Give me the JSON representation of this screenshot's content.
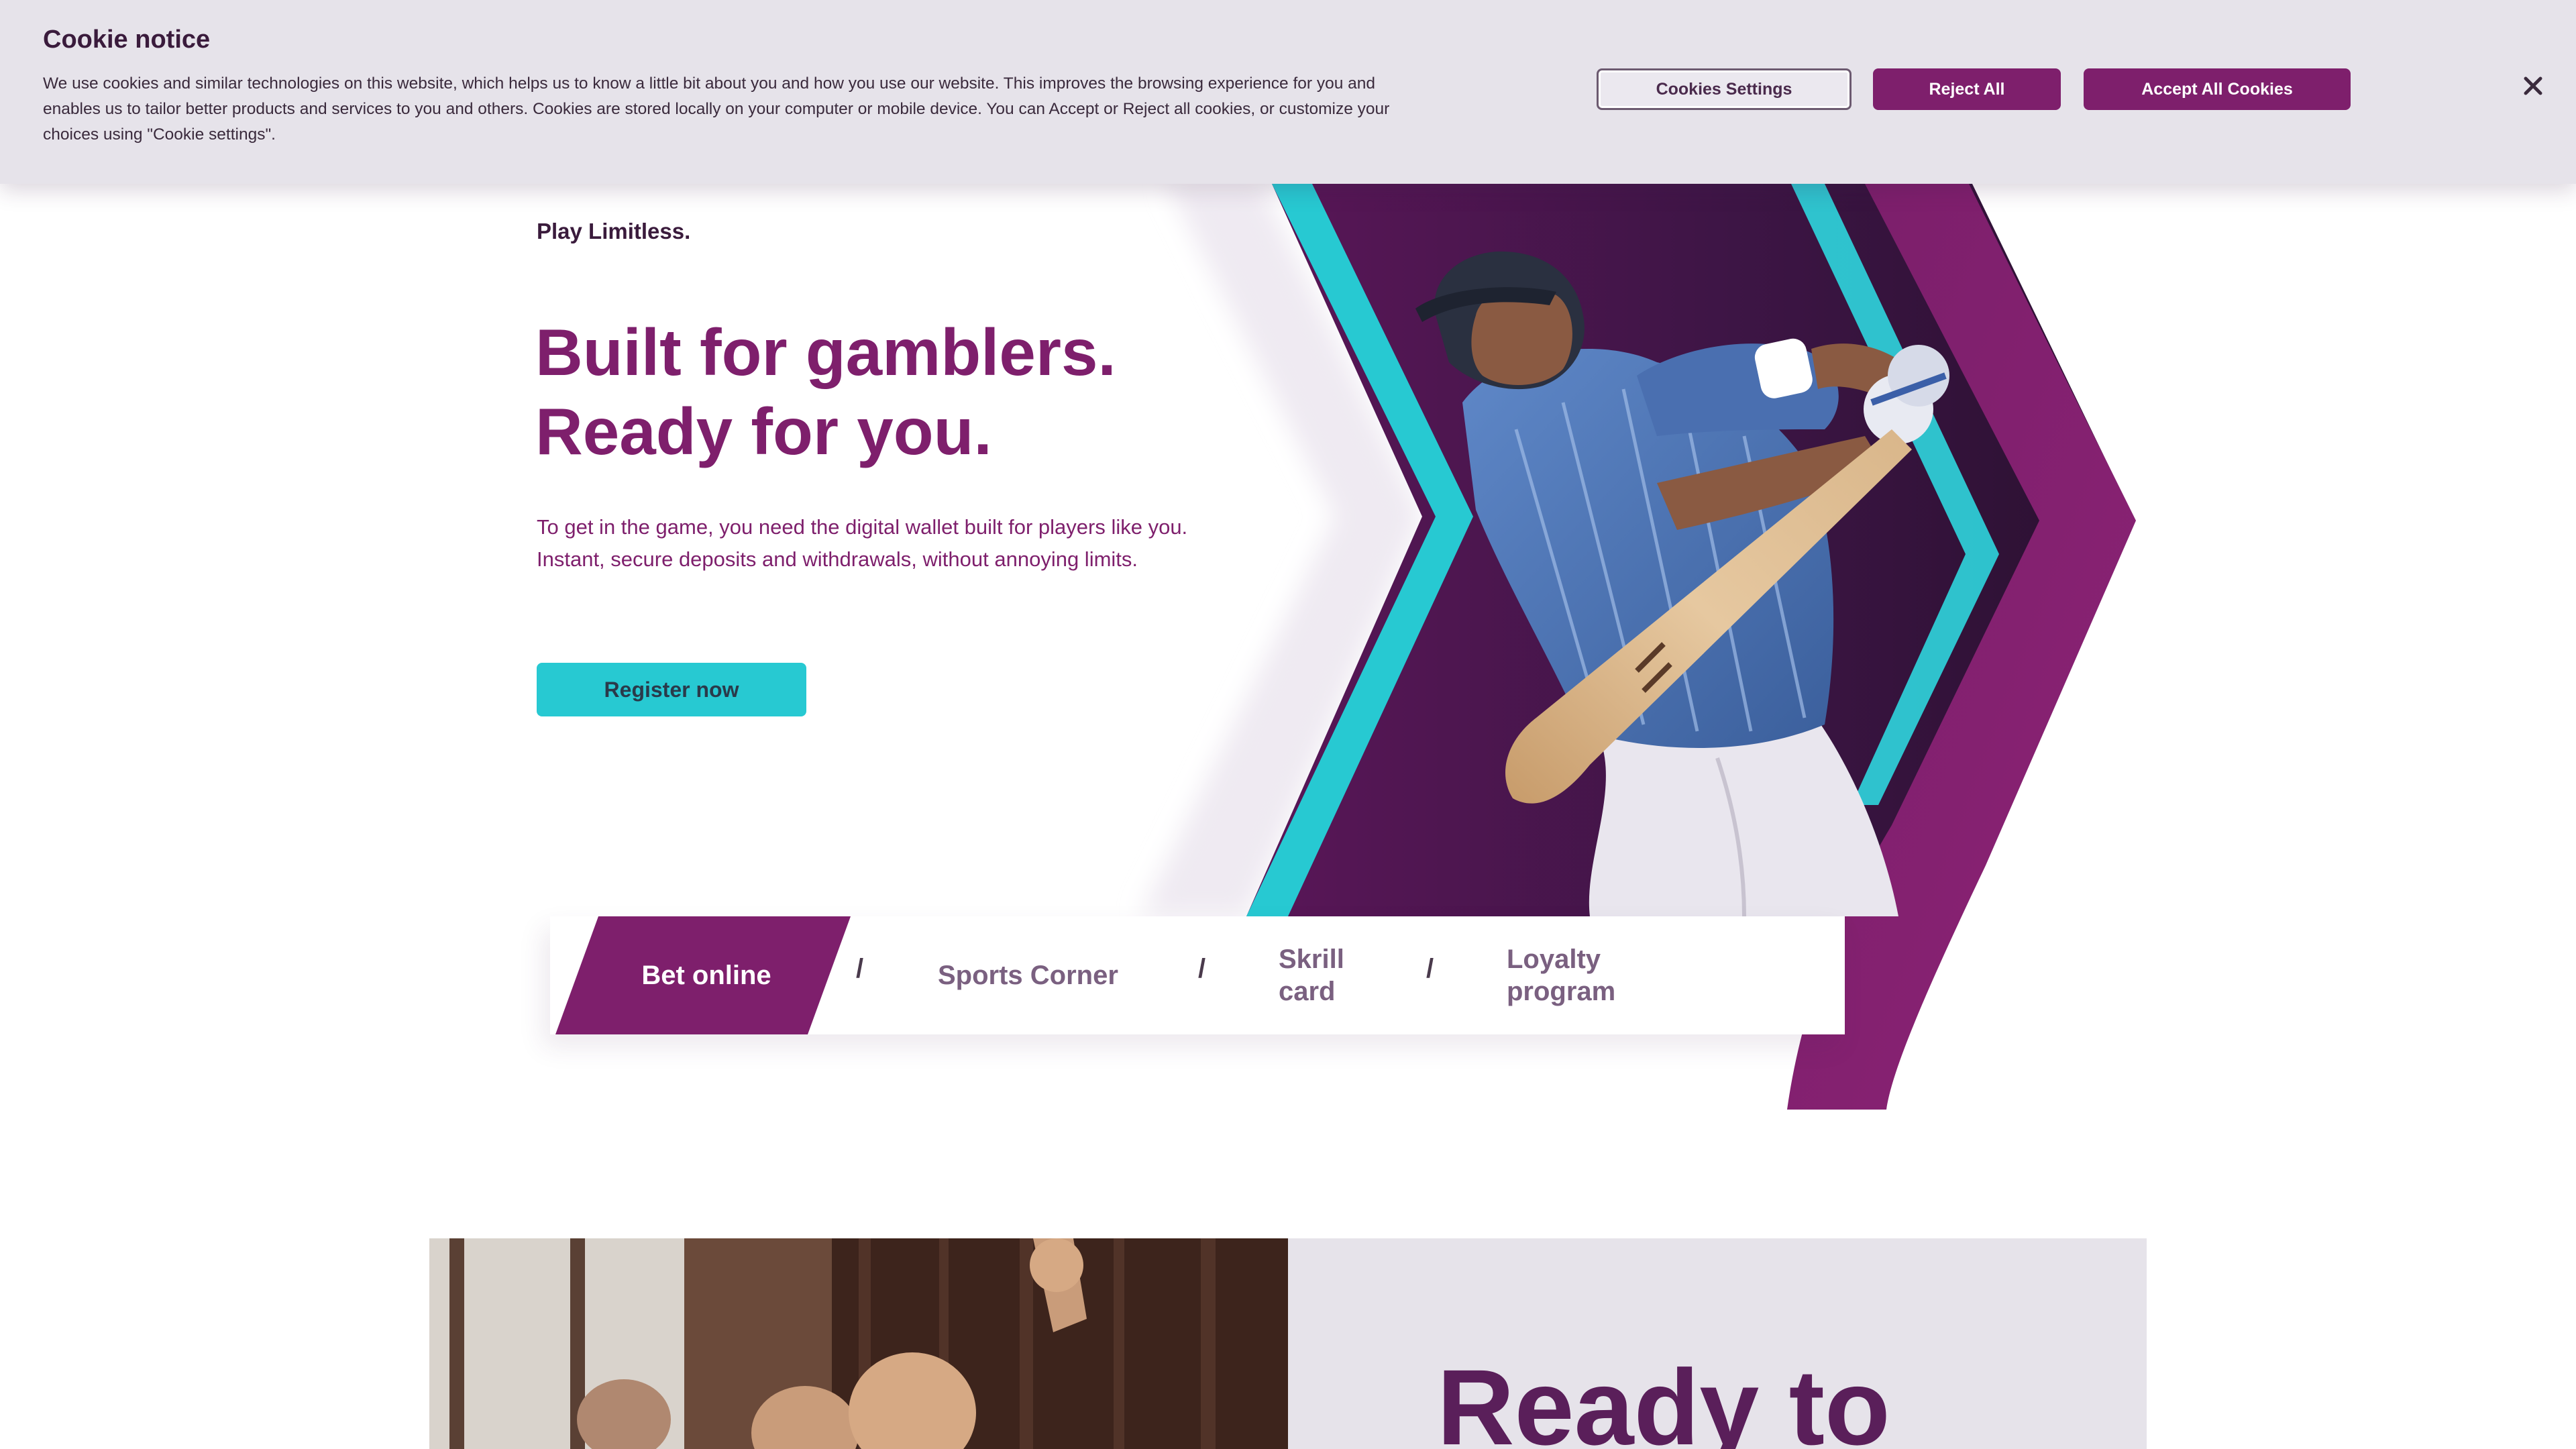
{
  "cookie_banner": {
    "title": "Cookie notice",
    "text": "We use cookies and similar technologies on this website, which helps us to know a little bit about you and how you use our website. This improves the browsing experience for you and enables us to tailor better products and services to you and others. Cookies are stored locally on your computer or mobile device. You can Accept or Reject all cookies, or customize your choices using \"Cookie settings\".",
    "settings_label": "Cookies Settings",
    "reject_label": "Reject All",
    "accept_label": "Accept All Cookies",
    "close_icon": "close-icon"
  },
  "hero": {
    "kicker": "Play Limitless.",
    "title_line1": "Built for gamblers.",
    "title_line2": "Ready for you.",
    "description": "To get in the game, you need the digital wallet built for players like you. Instant, secure deposits and withdrawals, without annoying limits.",
    "cta_label": "Register now"
  },
  "tabs": {
    "items": [
      {
        "label": "Bet online",
        "active": true
      },
      {
        "label": "Sports Corner",
        "active": false
      },
      {
        "label": "Skrill card",
        "active": false
      },
      {
        "label": "Loyalty program",
        "active": false
      }
    ],
    "separator": "/"
  },
  "lower": {
    "heading": "Ready to"
  },
  "colors": {
    "brand_purple": "#7e1f6c",
    "dark_purple": "#3a1b3c",
    "accent_teal": "#27c9d2",
    "banner_bg": "#e6e3ea"
  }
}
